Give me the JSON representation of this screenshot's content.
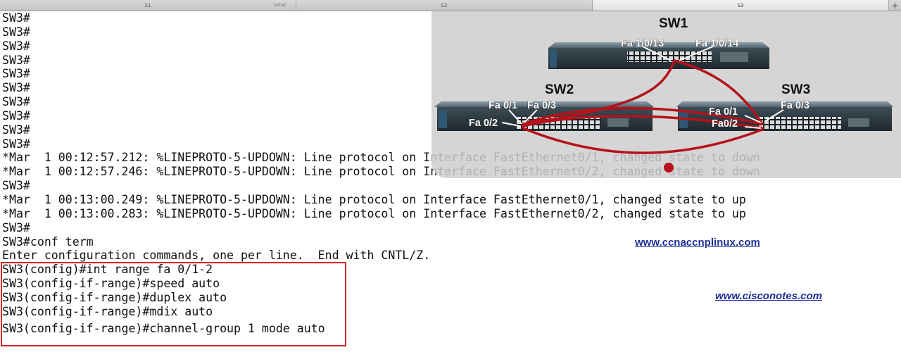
{
  "tabs": [
    {
      "label": "S1",
      "sub": "telnet..."
    },
    {
      "label": "S2",
      "sub": ""
    },
    {
      "label": "S3",
      "sub": ""
    }
  ],
  "tab_add_label": "+",
  "terminal": {
    "lines": [
      "SW3#",
      "SW3#",
      "SW3#",
      "SW3#",
      "SW3#",
      "SW3#",
      "SW3#",
      "SW3#",
      "SW3#",
      "SW3#",
      "*Mar  1 00:12:57.212: %LINEPROTO-5-UPDOWN: Line protocol on Interface FastEthernet0/1, changed state to down",
      "*Mar  1 00:12:57.246: %LINEPROTO-5-UPDOWN: Line protocol on Interface FastEthernet0/2, changed state to down",
      "SW3#",
      "*Mar  1 00:13:00.249: %LINEPROTO-5-UPDOWN: Line protocol on Interface FastEthernet0/1, changed state to up",
      "*Mar  1 00:13:00.283: %LINEPROTO-5-UPDOWN: Line protocol on Interface FastEthernet0/2, changed state to up",
      "SW3#",
      "SW3#conf term",
      "Enter configuration commands, one per line.  End with CNTL/Z.",
      "SW3(config)#int range fa 0/1-2",
      "SW3(config-if-range)#speed auto",
      "SW3(config-if-range)#duplex auto",
      "SW3(config-if-range)#mdix auto",
      "SW3(config-if-range)#channel-group 1 mode auto"
    ]
  },
  "diagram": {
    "switches": {
      "sw1": "SW1",
      "sw2": "SW2",
      "sw3": "SW3"
    },
    "ports": {
      "sw1_a": "Fa 1/0/13",
      "sw1_b": "Fa 1/0/14",
      "sw2_a": "Fa 0/1",
      "sw2_b": "Fa 0/3",
      "sw2_c": "Fa 0/2",
      "sw3_a": "Fa 0/1",
      "sw3_b": "Fa 0/3",
      "sw3_c": "Fa0/2"
    },
    "cable_color": "#b5121b"
  },
  "links": {
    "ccna": "www.ccnaccnplinux.com",
    "cisconotes": "www.cisconotes.com"
  },
  "colors": {
    "highlight_box": "#d0232a",
    "link": "#1f2f97"
  }
}
